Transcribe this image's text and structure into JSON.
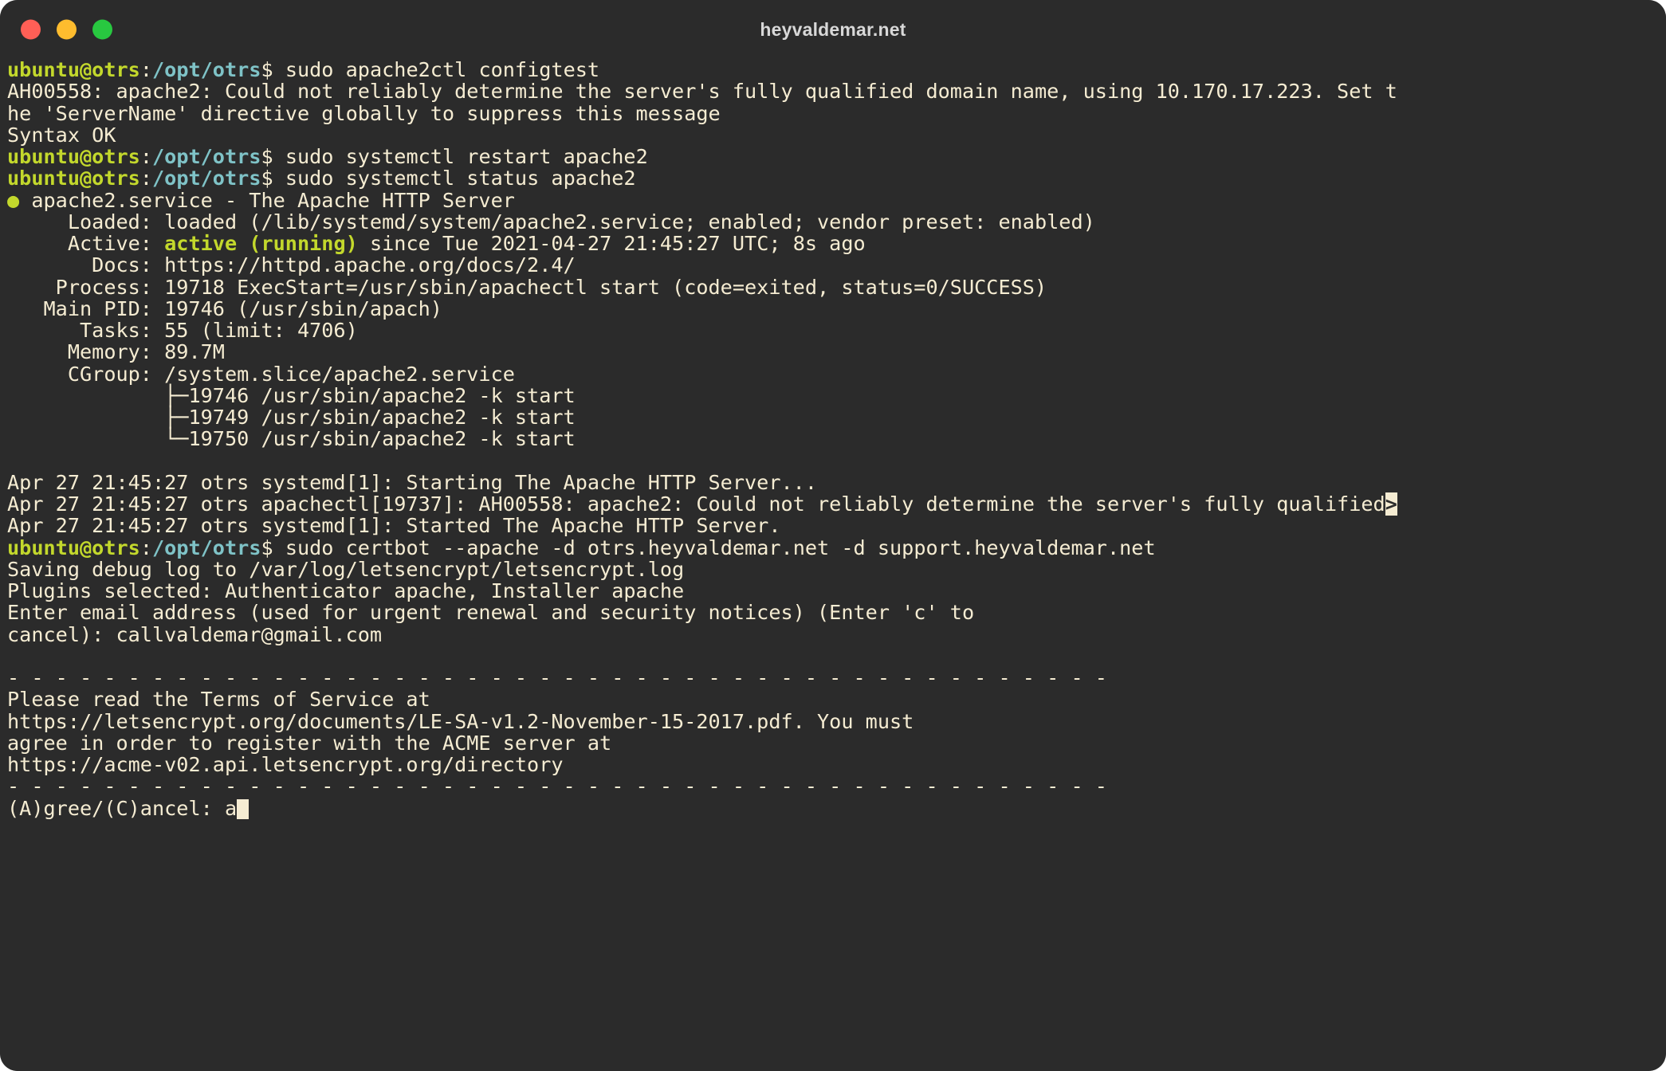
{
  "window": {
    "title": "heyvaldemar.net",
    "traffic_lights": [
      {
        "name": "close-button",
        "color": "#ff5f56"
      },
      {
        "name": "minimize-button",
        "color": "#febc2e"
      },
      {
        "name": "maximize-button",
        "color": "#28c840"
      }
    ],
    "background": "#2b2b2b",
    "foreground": "#f5ecd2"
  },
  "prompt": {
    "user_host": "ubuntu@otrs",
    "colon": ":",
    "cwd": "/opt/otrs",
    "sigil": "$ "
  },
  "terminal": {
    "lines": [
      {
        "type": "prompt",
        "command": "sudo apache2ctl configtest"
      },
      {
        "type": "text",
        "text": "AH00558: apache2: Could not reliably determine the server's fully qualified domain name, using 10.170.17.223. Set t"
      },
      {
        "type": "text",
        "text": "he 'ServerName' directive globally to suppress this message"
      },
      {
        "type": "text",
        "text": "Syntax OK"
      },
      {
        "type": "prompt",
        "command": "sudo systemctl restart apache2"
      },
      {
        "type": "prompt",
        "command": "sudo systemctl status apache2"
      },
      {
        "type": "status",
        "dot": "●",
        "text": " apache2.service - The Apache HTTP Server"
      },
      {
        "type": "text",
        "text": "     Loaded: loaded (/lib/systemd/system/apache2.service; enabled; vendor preset: enabled)"
      },
      {
        "type": "active",
        "prefix": "     Active: ",
        "highlight": "active (running)",
        "suffix": " since Tue 2021-04-27 21:45:27 UTC; 8s ago"
      },
      {
        "type": "text",
        "text": "       Docs: https://httpd.apache.org/docs/2.4/"
      },
      {
        "type": "text",
        "text": "    Process: 19718 ExecStart=/usr/sbin/apachectl start (code=exited, status=0/SUCCESS)"
      },
      {
        "type": "text",
        "text": "   Main PID: 19746 (/usr/sbin/apach)"
      },
      {
        "type": "text",
        "text": "      Tasks: 55 (limit: 4706)"
      },
      {
        "type": "text",
        "text": "     Memory: 89.7M"
      },
      {
        "type": "text",
        "text": "     CGroup: /system.slice/apache2.service"
      },
      {
        "type": "text",
        "text": "             ├─19746 /usr/sbin/apache2 -k start"
      },
      {
        "type": "text",
        "text": "             ├─19749 /usr/sbin/apache2 -k start"
      },
      {
        "type": "text",
        "text": "             └─19750 /usr/sbin/apache2 -k start"
      },
      {
        "type": "blank"
      },
      {
        "type": "text",
        "text": "Apr 27 21:45:27 otrs systemd[1]: Starting The Apache HTTP Server..."
      },
      {
        "type": "trunc",
        "text": "Apr 27 21:45:27 otrs apachectl[19737]: AH00558: apache2: Could not reliably determine the server's fully qualified",
        "marker": ">"
      },
      {
        "type": "text",
        "text": "Apr 27 21:45:27 otrs systemd[1]: Started The Apache HTTP Server."
      },
      {
        "type": "prompt",
        "command": "sudo certbot --apache -d otrs.heyvaldemar.net -d support.heyvaldemar.net"
      },
      {
        "type": "text",
        "text": "Saving debug log to /var/log/letsencrypt/letsencrypt.log"
      },
      {
        "type": "text",
        "text": "Plugins selected: Authenticator apache, Installer apache"
      },
      {
        "type": "text",
        "text": "Enter email address (used for urgent renewal and security notices) (Enter 'c' to"
      },
      {
        "type": "text",
        "text": "cancel): callvaldemar@gmail.com"
      },
      {
        "type": "blank"
      },
      {
        "type": "text",
        "text": "- - - - - - - - - - - - - - - - - - - - - - - - - - - - - - - - - - - - - - - - - - - - - -"
      },
      {
        "type": "text",
        "text": "Please read the Terms of Service at"
      },
      {
        "type": "text",
        "text": "https://letsencrypt.org/documents/LE-SA-v1.2-November-15-2017.pdf. You must"
      },
      {
        "type": "text",
        "text": "agree in order to register with the ACME server at"
      },
      {
        "type": "text",
        "text": "https://acme-v02.api.letsencrypt.org/directory"
      },
      {
        "type": "text",
        "text": "- - - - - - - - - - - - - - - - - - - - - - - - - - - - - - - - - - - - - - - - - - - - - -"
      },
      {
        "type": "input",
        "text": "(A)gree/(C)ancel: ",
        "value": "a"
      }
    ]
  }
}
